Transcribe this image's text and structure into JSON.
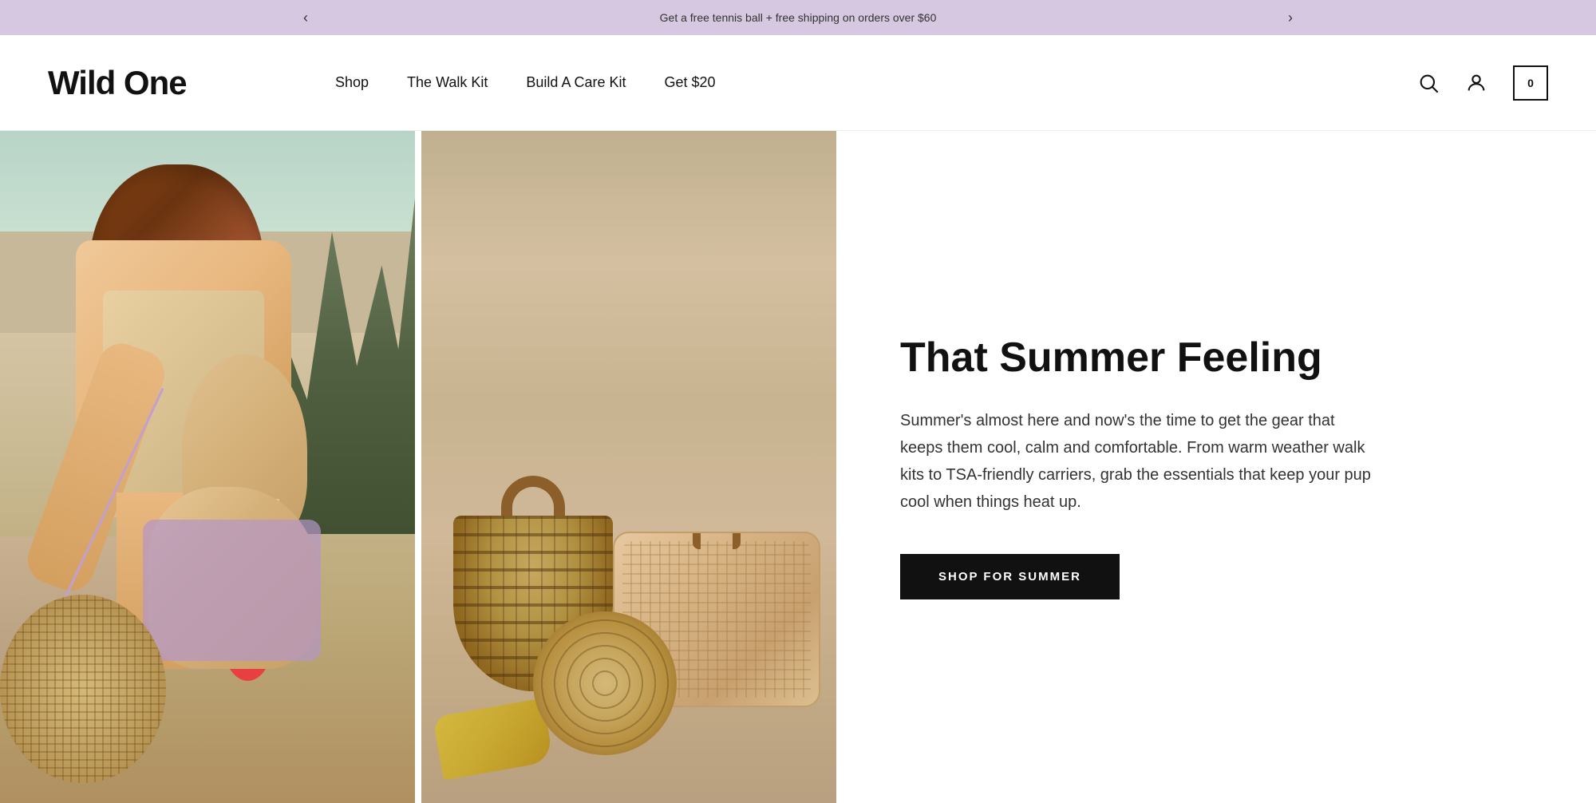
{
  "announcement": {
    "text": "Get a free tennis ball + free shipping on orders over $60",
    "prev_label": "‹",
    "next_label": "›"
  },
  "header": {
    "logo": "Wild One",
    "nav": [
      {
        "label": "Shop",
        "href": "#"
      },
      {
        "label": "The Walk Kit",
        "href": "#"
      },
      {
        "label": "Build A Care Kit",
        "href": "#"
      },
      {
        "label": "Get $20",
        "href": "#"
      }
    ],
    "cart_count": "0",
    "icons": {
      "search": "search-icon",
      "account": "account-icon",
      "cart": "cart-icon"
    }
  },
  "hero": {
    "heading": "That Summer Feeling",
    "body": "Summer's almost here and now's the time to get the gear that keeps them cool, calm and comfortable. From warm weather walk kits to TSA-friendly carriers, grab the essentials that keep your pup cool when things heat up.",
    "cta_label": "SHOP FOR SUMMER",
    "cta_href": "#"
  }
}
